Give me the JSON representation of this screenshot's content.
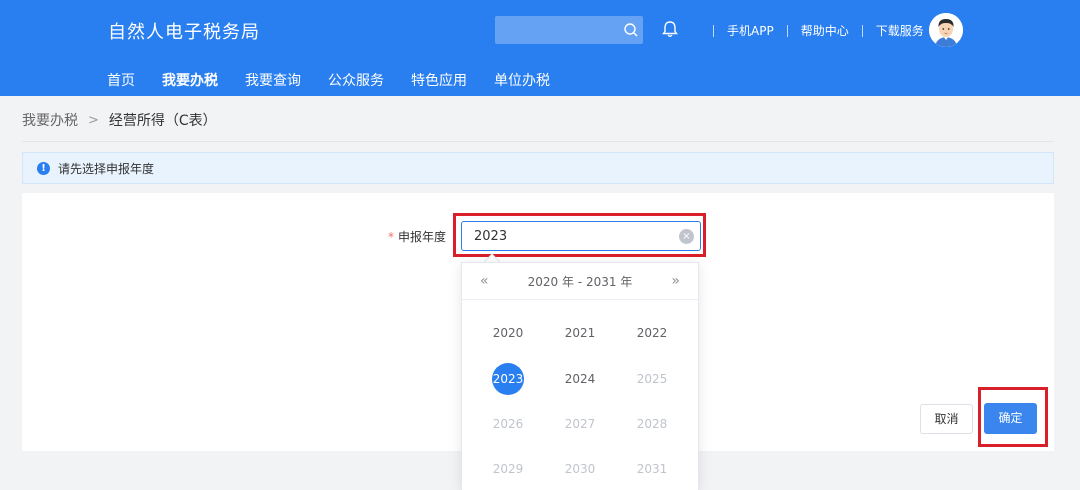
{
  "header": {
    "title": "自然人电子税务局",
    "search": {
      "value": "",
      "placeholder": ""
    },
    "links": [
      "手机APP",
      "帮助中心",
      "下载服务"
    ],
    "nav": [
      {
        "label": "首页",
        "active": false
      },
      {
        "label": "我要办税",
        "active": true
      },
      {
        "label": "我要查询",
        "active": false
      },
      {
        "label": "公众服务",
        "active": false
      },
      {
        "label": "特色应用",
        "active": false
      },
      {
        "label": "单位办税",
        "active": false
      }
    ]
  },
  "breadcrumb": {
    "parent": "我要办税",
    "separator": ">",
    "current": "经营所得（C表）"
  },
  "notice": {
    "text": "请先选择申报年度",
    "icon": "info-icon"
  },
  "form": {
    "required_mark": "*",
    "year_label": "申报年度",
    "year_value": "2023"
  },
  "picker": {
    "prev": "«",
    "next": "»",
    "range_label": "2020 年 - 2031 年",
    "years": [
      {
        "label": "2020",
        "state": "normal"
      },
      {
        "label": "2021",
        "state": "normal"
      },
      {
        "label": "2022",
        "state": "normal"
      },
      {
        "label": "2023",
        "state": "selected"
      },
      {
        "label": "2024",
        "state": "normal"
      },
      {
        "label": "2025",
        "state": "disabled"
      },
      {
        "label": "2026",
        "state": "disabled"
      },
      {
        "label": "2027",
        "state": "disabled"
      },
      {
        "label": "2028",
        "state": "disabled"
      },
      {
        "label": "2029",
        "state": "disabled"
      },
      {
        "label": "2030",
        "state": "disabled"
      },
      {
        "label": "2031",
        "state": "disabled"
      }
    ]
  },
  "buttons": {
    "cancel": "取消",
    "confirm": "确定"
  },
  "colors": {
    "brand": "#2a7ff0",
    "highlight": "#d9202a",
    "required": "#f56c6c"
  }
}
